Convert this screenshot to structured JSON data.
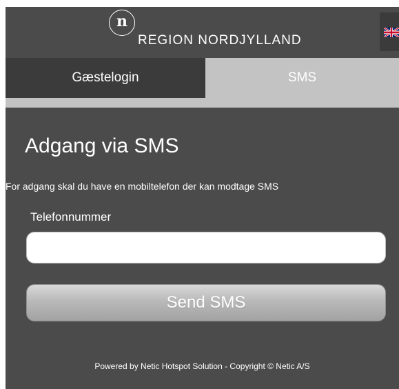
{
  "header": {
    "logo_mark": "n",
    "logo_text": "REGION NORDJYLLAND",
    "language_icon": "uk-flag-icon"
  },
  "tabs": [
    {
      "label": "Gæstelogin",
      "active": false
    },
    {
      "label": "SMS",
      "active": true
    }
  ],
  "main": {
    "title": "Adgang via SMS",
    "description": "For adgang skal du have en mobiltelefon der kan modtage SMS",
    "phone_label": "Telefonnummer",
    "phone_value": "",
    "phone_placeholder": "",
    "send_button_label": "Send SMS"
  },
  "footer": {
    "text": "Powered by Netic Hotspot Solution - Copyright © Netic A/S"
  },
  "colors": {
    "background": "#4b4b4b",
    "active_tab": "#c3c3c3",
    "inactive_tab": "#3b3b3b"
  }
}
